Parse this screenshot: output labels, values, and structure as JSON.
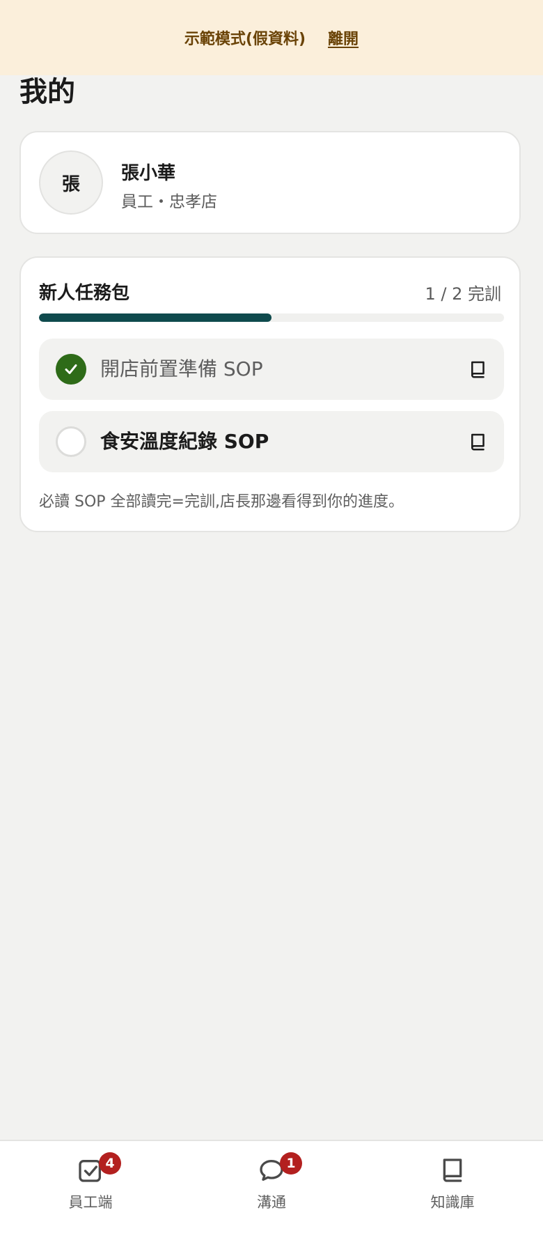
{
  "demo_banner": {
    "text": "示範模式(假資料)",
    "exit_label": "離開"
  },
  "page": {
    "title": "我的"
  },
  "profile": {
    "avatar_text": "張",
    "name": "張小華",
    "role": "員工・忠孝店"
  },
  "onboarding": {
    "title": "新人任務包",
    "progress_text": "1 / 2 完訓",
    "progress_fraction": 0.5,
    "tasks": [
      {
        "label": "開店前置準備 SOP",
        "status": "done",
        "icon": "book-icon"
      },
      {
        "label": "食安溫度紀錄 SOP",
        "status": "todo",
        "icon": "book-icon"
      }
    ],
    "note": "必讀 SOP 全部讀完=完訓,店長那邊看得到你的進度。"
  },
  "bottom_nav": {
    "items": [
      {
        "label": "員工端",
        "icon": "checkbox-icon",
        "badge": "4"
      },
      {
        "label": "溝通",
        "icon": "chat-bubble-icon",
        "badge": "1"
      },
      {
        "label": "知識庫",
        "icon": "book-icon",
        "badge": ""
      }
    ]
  },
  "colors": {
    "banner_bg": "#fbefdb",
    "banner_text": "#6a4307",
    "progress_fill": "#0f4a4d",
    "done_check": "#2e6b18",
    "badge": "#b3201f",
    "page_bg": "#f2f2f0"
  }
}
